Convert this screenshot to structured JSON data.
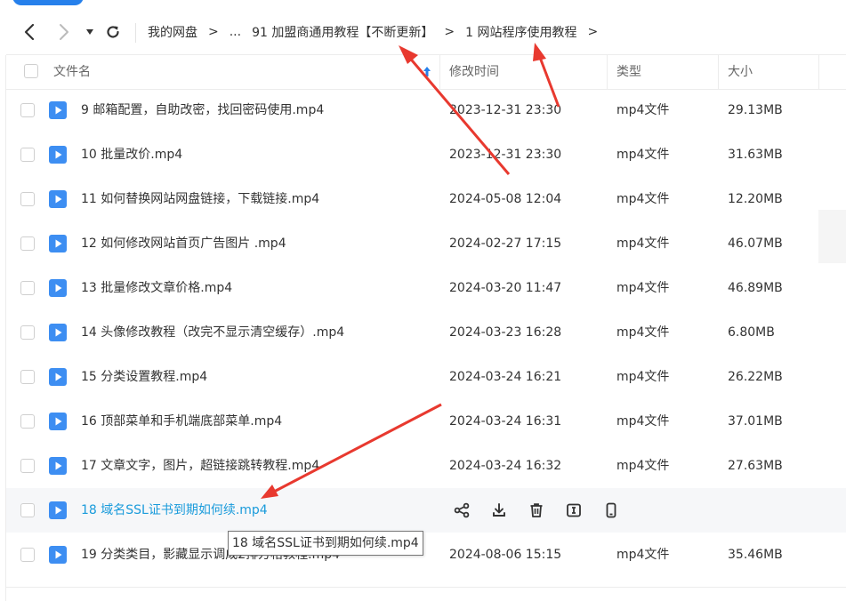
{
  "toolbar": {
    "back_icon": "arrow-left-icon",
    "forward_icon": "arrow-right-icon",
    "history_icon": "caret-down-icon",
    "refresh_icon": "refresh-icon"
  },
  "breadcrumb": {
    "items": [
      "我的网盘",
      "...",
      "91 加盟商通用教程【不断更新】",
      "1 网站程序使用教程"
    ],
    "separator": ">"
  },
  "table": {
    "columns": {
      "name": "文件名",
      "modified": "修改时间",
      "type": "类型",
      "size": "大小"
    },
    "sort_icon": "sort-arrow-up-icon",
    "rows": [
      {
        "name": "9 邮箱配置，自助改密，找回密码使用.mp4",
        "modified": "2023-12-31 23:30",
        "type": "mp4文件",
        "size": "29.13MB"
      },
      {
        "name": "10 批量改价.mp4",
        "modified": "2023-12-31 23:30",
        "type": "mp4文件",
        "size": "31.63MB"
      },
      {
        "name": "11 如何替换网站网盘链接，下载链接.mp4",
        "modified": "2024-05-08 12:04",
        "type": "mp4文件",
        "size": "12.20MB"
      },
      {
        "name": "12 如何修改网站首页广告图片 .mp4",
        "modified": "2024-02-27 17:15",
        "type": "mp4文件",
        "size": "46.07MB"
      },
      {
        "name": "13 批量修改文章价格.mp4",
        "modified": "2024-03-20 11:47",
        "type": "mp4文件",
        "size": "46.89MB"
      },
      {
        "name": "14 头像修改教程（改完不显示清空缓存）.mp4",
        "modified": "2024-03-23 16:28",
        "type": "mp4文件",
        "size": "6.80MB"
      },
      {
        "name": "15 分类设置教程.mp4",
        "modified": "2024-03-24 16:21",
        "type": "mp4文件",
        "size": "26.22MB"
      },
      {
        "name": "16 顶部菜单和手机端底部菜单.mp4",
        "modified": "2024-03-24 16:31",
        "type": "mp4文件",
        "size": "37.01MB"
      },
      {
        "name": "17 文章文字，图片，超链接跳转教程.mp4",
        "modified": "2024-03-24 16:32",
        "type": "mp4文件",
        "size": "27.63MB"
      },
      {
        "name": "18 域名SSL证书到期如何续.mp4",
        "modified": "",
        "type": "",
        "size": ""
      },
      {
        "name": "19 分类类目，影藏显示调成2排方格教程.mp4",
        "modified": "2024-08-06 15:15",
        "type": "mp4文件",
        "size": "35.46MB"
      }
    ],
    "hover_actions": [
      "share-icon",
      "download-icon",
      "delete-icon",
      "rename-icon",
      "mobile-icon"
    ]
  },
  "tooltip": {
    "text": "18 域名SSL证书到期如何续.mp4"
  },
  "colors": {
    "accent": "#2680eb",
    "file_icon": "#3d8ef2",
    "hover_text": "#1a9bdb",
    "annotation_arrow": "#e8392f"
  }
}
